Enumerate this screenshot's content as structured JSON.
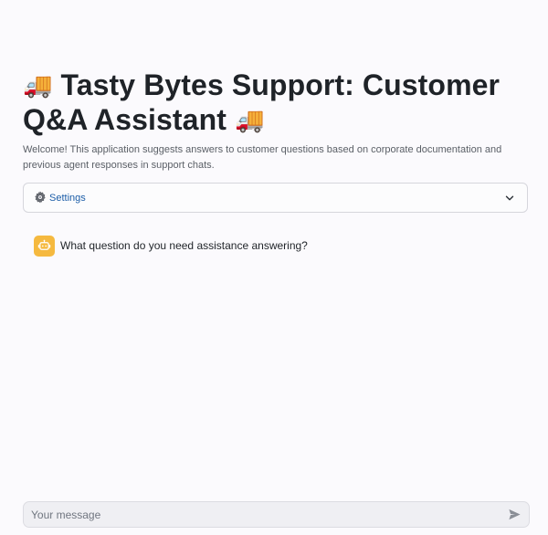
{
  "header": {
    "title_emoji_left": "🚚",
    "title_text": "Tasty Bytes Support: Customer Q&A Assistant",
    "title_emoji_right": "🚚",
    "intro": "Welcome! This application suggests answers to customer questions based on corporate documentation and previous agent responses in support chats."
  },
  "settings_expander": {
    "label": "Settings",
    "icon": "gear-icon",
    "toggle_icon": "chevron-down-icon"
  },
  "chat": {
    "messages": [
      {
        "role": "assistant",
        "avatar_icon": "bot-icon",
        "text": "What question do you need assistance answering?"
      }
    ]
  },
  "composer": {
    "placeholder": "Your message",
    "value": "",
    "send_icon": "send-icon"
  },
  "colors": {
    "background": "#fbfafd",
    "link_blue": "#1d5ea8",
    "avatar_orange": "#f5b93f",
    "text_dark": "#1f2328",
    "text_muted": "#5a5f66"
  }
}
